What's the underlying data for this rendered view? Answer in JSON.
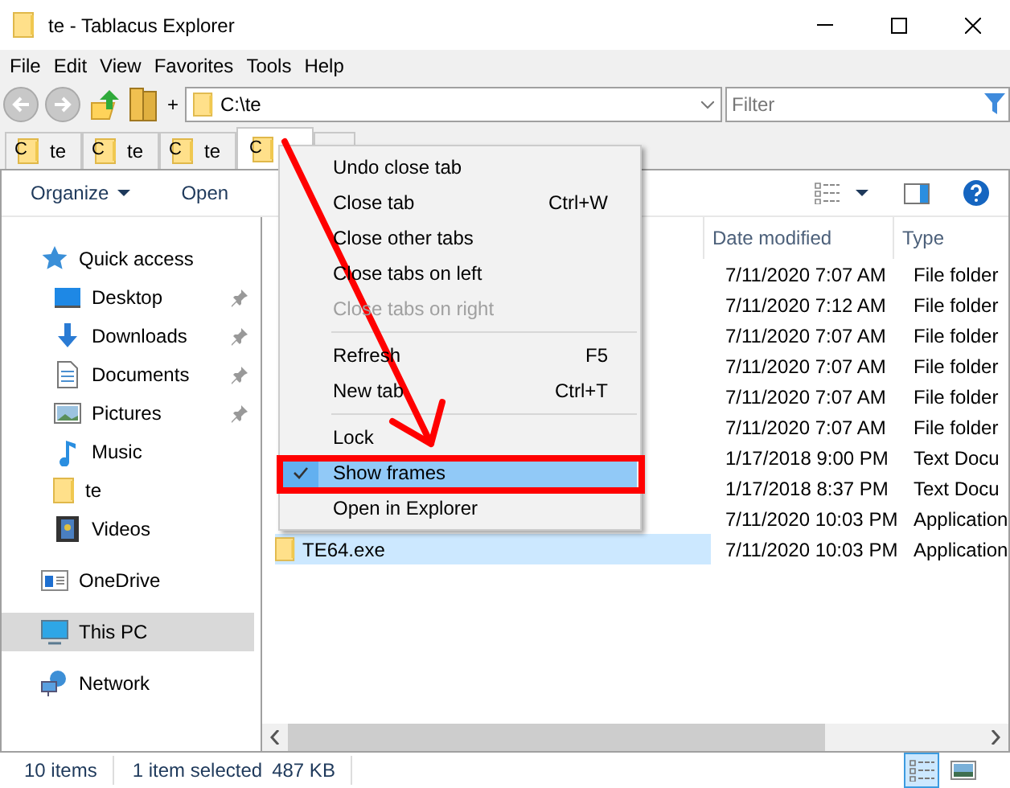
{
  "window": {
    "title": "te - Tablacus Explorer"
  },
  "menu_bar": [
    "File",
    "Edit",
    "View",
    "Favorites",
    "Tools",
    "Help"
  ],
  "address": {
    "plus": "+",
    "value": "C:\\te"
  },
  "filter": {
    "placeholder": "Filter"
  },
  "tabs": [
    {
      "drive": "C",
      "label": "te",
      "selected": false
    },
    {
      "drive": "C",
      "label": "te",
      "selected": false
    },
    {
      "drive": "C",
      "label": "te",
      "selected": false
    },
    {
      "drive": "C",
      "selected": true
    }
  ],
  "command_bar": {
    "organize": "Organize",
    "open": "Open"
  },
  "nav": [
    {
      "kind": "star",
      "label": "Quick access",
      "pinned": false,
      "selected": false,
      "children": [
        {
          "kind": "desktop",
          "label": "Desktop",
          "pinned": true,
          "selected": false
        },
        {
          "kind": "download",
          "label": "Downloads",
          "pinned": true,
          "selected": false
        },
        {
          "kind": "document",
          "label": "Documents",
          "pinned": true,
          "selected": false
        },
        {
          "kind": "pictures",
          "label": "Pictures",
          "pinned": true,
          "selected": false
        },
        {
          "kind": "music",
          "label": "Music",
          "pinned": false,
          "selected": false
        },
        {
          "kind": "folder",
          "label": "te",
          "pinned": false,
          "selected": false
        },
        {
          "kind": "videos",
          "label": "Videos",
          "pinned": false,
          "selected": false
        }
      ]
    },
    {
      "kind": "cloud",
      "label": "OneDrive",
      "pinned": false,
      "selected": false
    },
    {
      "kind": "pc",
      "label": "This PC",
      "pinned": false,
      "selected": true
    },
    {
      "kind": "network",
      "label": "Network",
      "pinned": false,
      "selected": false
    }
  ],
  "columns": [
    "Date modified",
    "Type"
  ],
  "rows": [
    {
      "date": "7/11/2020 7:07 AM",
      "type": "File folder",
      "selected": false
    },
    {
      "date": "7/11/2020 7:12 AM",
      "type": "File folder",
      "selected": false
    },
    {
      "date": "7/11/2020 7:07 AM",
      "type": "File folder",
      "selected": false
    },
    {
      "date": "7/11/2020 7:07 AM",
      "type": "File folder",
      "selected": false
    },
    {
      "date": "7/11/2020 7:07 AM",
      "type": "File folder",
      "selected": false
    },
    {
      "date": "7/11/2020 7:07 AM",
      "type": "File folder",
      "selected": false
    },
    {
      "date": "1/17/2018 9:00 PM",
      "type": "Text Docu",
      "selected": false
    },
    {
      "date": "1/17/2018 8:37 PM",
      "type": "Text Docu",
      "selected": false
    },
    {
      "date": "7/11/2020 10:03 PM",
      "type": "Application",
      "selected": false
    },
    {
      "name": "TE64.exe",
      "date": "7/11/2020 10:03 PM",
      "type": "Application",
      "selected": true
    }
  ],
  "status": {
    "count": "10 items",
    "selection": "1 item selected",
    "size": "487 KB"
  },
  "view_buttons": [
    {
      "kind": "details",
      "selected": true
    },
    {
      "kind": "thumbnails",
      "selected": false
    }
  ],
  "context_menu": [
    {
      "kind": "item",
      "label": "Undo close tab",
      "disabled": false,
      "checked": false,
      "highlighted": false
    },
    {
      "kind": "item",
      "label": "Close tab",
      "shortcut": "Ctrl+W",
      "disabled": false,
      "checked": false,
      "highlighted": false
    },
    {
      "kind": "item",
      "label": "Close other tabs",
      "disabled": false,
      "checked": false,
      "highlighted": false
    },
    {
      "kind": "item",
      "label": "Close tabs on left",
      "disabled": false,
      "checked": false,
      "highlighted": false
    },
    {
      "kind": "item",
      "label": "Close tabs on right",
      "disabled": true,
      "checked": false,
      "highlighted": false
    },
    {
      "kind": "separator"
    },
    {
      "kind": "item",
      "label": "Refresh",
      "shortcut": "F5",
      "disabled": false,
      "checked": false,
      "highlighted": false
    },
    {
      "kind": "item",
      "label": "New tab",
      "shortcut": "Ctrl+T",
      "disabled": false,
      "checked": false,
      "highlighted": false
    },
    {
      "kind": "separator"
    },
    {
      "kind": "item",
      "label": "Lock",
      "disabled": false,
      "checked": false,
      "highlighted": false
    },
    {
      "kind": "item",
      "label": "Show frames",
      "disabled": false,
      "checked": true,
      "highlighted": true
    },
    {
      "kind": "item",
      "label": "Open in Explorer",
      "disabled": false,
      "checked": false,
      "highlighted": false
    }
  ]
}
